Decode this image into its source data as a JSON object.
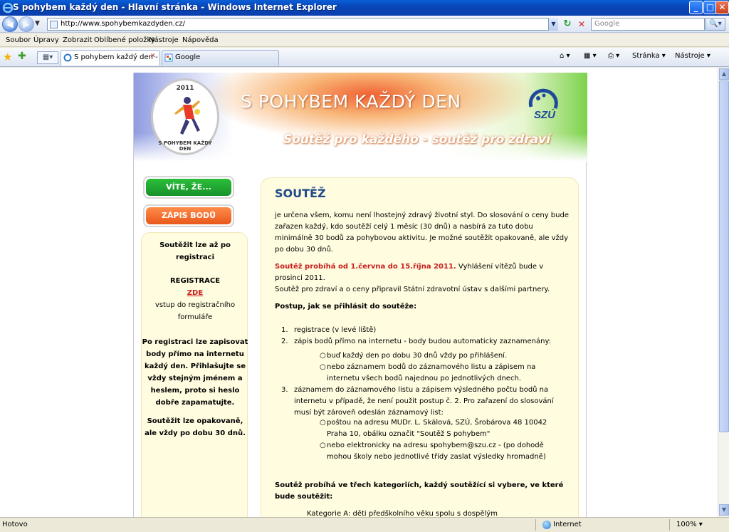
{
  "window": {
    "title": "S pohybem každý den - Hlavní stránka - Windows Internet Explorer",
    "min": "_",
    "max": "□",
    "close": "✕"
  },
  "address": {
    "url": "http://www.spohybemkazdyden.cz/",
    "search_placeholder": "Google",
    "back": "◀",
    "forward": "▶",
    "dropdown": "▼",
    "refresh": "↻",
    "stop": "✕",
    "search_button": "🔍▾"
  },
  "menu": [
    "Soubor",
    "Úpravy",
    "Zobrazit",
    "Oblíbené položky",
    "Nástroje",
    "Nápověda"
  ],
  "tabs": {
    "active": "S pohybem každý den - H...",
    "close": "✕",
    "second": "Google"
  },
  "commands": {
    "home": "⌂ ▾",
    "feeds": "▦ ▾",
    "print": "⎙ ▾",
    "page": "Stránka ▾",
    "tools": "Nástroje ▾"
  },
  "banner": {
    "year": "2011",
    "ring_text": "S POHYBEM KAŽDÝ DEN",
    "title": "S POHYBEM KAŽDÝ DEN",
    "tagline": "Soutěž pro každého - soutěž pro zdraví"
  },
  "buttons": {
    "vite": "VÍTE, ŽE...",
    "zapis": "ZÁPIS BODŮ"
  },
  "sidebar": {
    "p1": "Soutěžit lze až po registraci",
    "reg": "REGISTRACE",
    "zde": "ZDE",
    "vstup": "vstup do registračního formuláře",
    "p3": "Po registraci lze zapisovat body přímo na internetu každý den. Přihlašujte se vždy stejným jménem a heslem, proto si heslo dobře zapamatujte.",
    "p4": "Soutěžit lze opakovaně, ale vždy po dobu 30 dnů."
  },
  "content": {
    "heading": "SOUTĚŽ",
    "intro": "je určena všem, komu není lhostejný zdravý životní styl. Do slosování o ceny bude zařazen každý, kdo soutěží celý 1 měsíc (30 dnů) a nasbírá za tuto dobu minimálně 30 bodů za pohybovou aktivitu. Je možné soutěžit opakovaně, ale vždy po dobu 30 dnů.",
    "dates_red": "Soutěž probíhá od 1.června do 15.října 2011.",
    "dates_rest": " Vyhlášení vítězů bude v prosinci 2011.",
    "partners": "Soutěž pro zdraví a o ceny připravil Státní zdravotní ústav s dalšími partnery.",
    "postup": "Postup, jak se přihlásit do soutěže:",
    "steps": [
      "registrace (v levé liště)",
      "zápis bodů přímo na internetu - body budou automaticky zaznamenány:",
      "záznamem do záznamového listu a zápisem výsledného počtu bodů na internetu v případě, že není použit postup č. 2. Pro zařazení do slosování musí být zároveň odeslán záznamový list:"
    ],
    "step_numbers": [
      "1.",
      "2.",
      "3."
    ],
    "sub2": [
      "buď každý den po dobu 30 dnů vždy po přihlášení.",
      "nebo záznamem bodů do záznamového listu a zápisem na internetu všech bodů najednou po jednotlivých dnech."
    ],
    "sub3": [
      "poštou na adresu MUDr. L. Skálová, SZÚ, Šrobárova 48 10042 Praha 10, obálku označit \"Soutěž S pohybem\"",
      "nebo elektronicky na adresu spohybem@szu.cz - (po dohodě mohou školy nebo jednotlivé třídy zaslat výsledky hromadně)"
    ],
    "bullet": "○",
    "categories": "Soutěž probíhá ve třech kategoriích, každý soutěžící si vybere, ve které bude soutěžit:",
    "cat_a": "Kategorie A: děti předškolního věku spolu s dospělým"
  },
  "status": {
    "text": "Hotovo",
    "zone": "Internet",
    "zoom": "100% ▾"
  }
}
